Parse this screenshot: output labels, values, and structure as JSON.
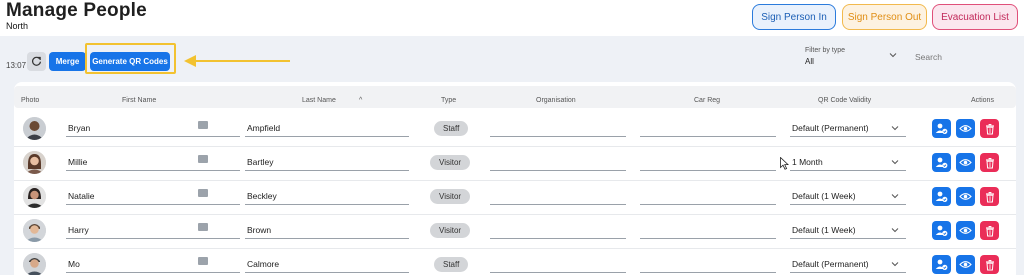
{
  "header": {
    "title": "Manage People",
    "subtitle": "North",
    "sign_in_label": "Sign Person In",
    "sign_out_label": "Sign Person Out",
    "evacuation_label": "Evacuation List"
  },
  "toolbar": {
    "time": "13:07",
    "merge_label": "Merge",
    "generate_qr_label": "Generate QR Codes",
    "filter_label": "Filter by type",
    "filter_value": "All",
    "search_placeholder": "Search"
  },
  "table": {
    "columns": {
      "photo": "Photo",
      "first_name": "First Name",
      "last_name": "Last Name",
      "type": "Type",
      "organisation": "Organisation",
      "car_reg": "Car Reg",
      "qr_validity": "QR Code Validity",
      "actions": "Actions"
    },
    "rows": [
      {
        "first_name": "Bryan",
        "last_name": "Ampfield",
        "type": "Staff",
        "organisation": "",
        "car_reg": "",
        "qr_validity": "Default (Permanent)"
      },
      {
        "first_name": "Millie",
        "last_name": "Bartley",
        "type": "Visitor",
        "organisation": "",
        "car_reg": "",
        "qr_validity": "1 Month"
      },
      {
        "first_name": "Natalie",
        "last_name": "Beckley",
        "type": "Visitor",
        "organisation": "",
        "car_reg": "",
        "qr_validity": "Default (1 Week)"
      },
      {
        "first_name": "Harry",
        "last_name": "Brown",
        "type": "Visitor",
        "organisation": "",
        "car_reg": "",
        "qr_validity": "Default (1 Week)"
      },
      {
        "first_name": "Mo",
        "last_name": "Calmore",
        "type": "Staff",
        "organisation": "",
        "car_reg": "",
        "qr_validity": "Default (Permanent)"
      }
    ]
  },
  "icons": {
    "refresh": "refresh-icon",
    "filter_chevron": "chevron-down-icon",
    "id_card": "id-card-icon",
    "person_check": "person-check-icon",
    "view": "eye-icon",
    "delete": "trash-icon",
    "arrow": "arrow-left-icon"
  },
  "colors": {
    "primary": "#1774e8",
    "sign_in": "#2b7bdc",
    "sign_out": "#f2b94d",
    "evacuation": "#e0507a",
    "delete": "#ea2d58",
    "highlight": "#f2c230"
  }
}
